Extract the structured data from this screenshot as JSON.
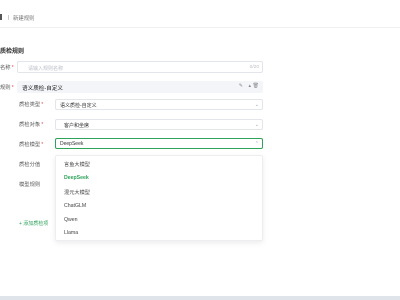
{
  "breadcrumb": {
    "current": "新建规则"
  },
  "section_title": "质检规则",
  "name_field": {
    "label": "名称",
    "required_mark": "*",
    "placeholder": "请输入规则名称",
    "count": "0/20"
  },
  "rule_field": {
    "label": "规则",
    "required_mark": "*"
  },
  "rule_card": {
    "title": "语义质检-自定义",
    "icons": [
      "edit-icon",
      "collapse-icon",
      "delete-icon"
    ],
    "rows": [
      {
        "label": "质检类型",
        "required": "*",
        "value": "语义质检-自定义"
      },
      {
        "label": "质检对象",
        "required": "*",
        "value": "客户和坐席"
      },
      {
        "label": "质检模型",
        "required": "*",
        "value": "DeepSeek"
      },
      {
        "label": "质检分值",
        "required": "",
        "value": ""
      },
      {
        "label": "模型规则",
        "required": "",
        "value": ""
      }
    ]
  },
  "model_dropdown": {
    "selected": "DeepSeek",
    "options": [
      "言鱼大模型",
      "DeepSeek",
      "混元大模型",
      "ChatGLM",
      "Qwen",
      "Llama"
    ]
  },
  "add_link": "+ 添加质检项",
  "colors": {
    "accent": "#2fa35a",
    "required": "#e5484d"
  }
}
